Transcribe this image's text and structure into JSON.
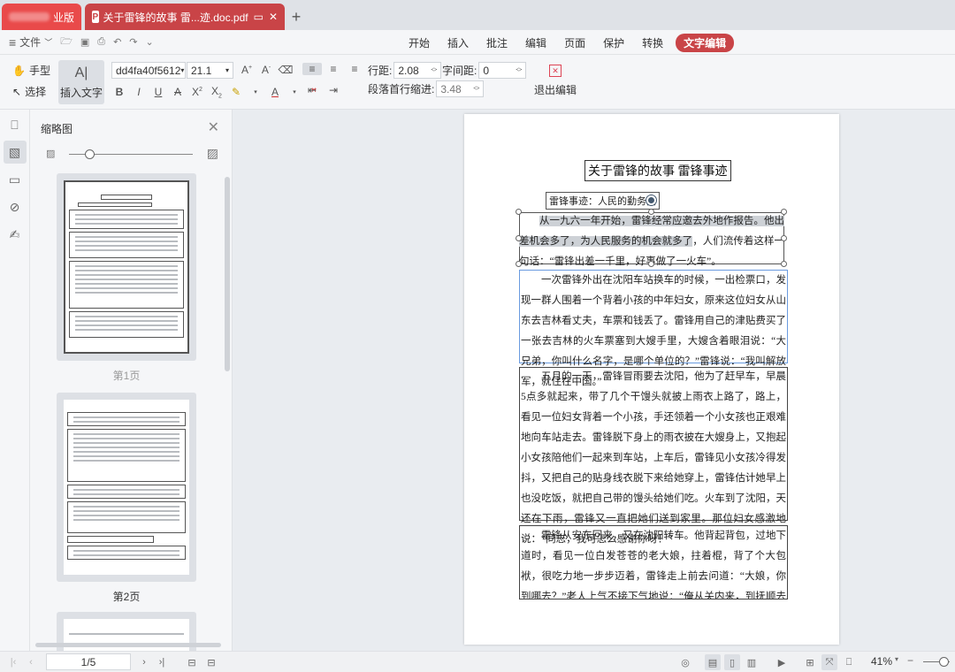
{
  "tabs": {
    "home_label": "业版",
    "active_label": "关于雷锋的故事 雷...迹.doc.pdf",
    "new_tab": "+"
  },
  "menubar": {
    "file_label": "文件",
    "tabs": [
      "开始",
      "插入",
      "批注",
      "编辑",
      "页面",
      "保护",
      "转换",
      "文字编辑"
    ],
    "active_tab": "文字编辑"
  },
  "toolbar": {
    "hand_label": "手型",
    "select_label": "选择",
    "insert_text_label": "插入文字",
    "font_name": "dd4fa40f5612",
    "font_size": "21.1",
    "line_spacing_label": "行距:",
    "line_spacing_value": "2.08",
    "char_spacing_label": "字间距:",
    "char_spacing_value": "0",
    "indent_label": "段落首行缩进:",
    "indent_value": "3.48",
    "exit_label": "退出编辑"
  },
  "thumbnail_panel": {
    "title": "缩略图",
    "pages": [
      "第1页",
      "第2页"
    ]
  },
  "document": {
    "title": "关于雷锋的故事 雷锋事迹",
    "subheading": "雷锋事迹：人民的勤务员",
    "para1_hl1": "从一九六一年开始，雷锋经常应邀去外地作报告。他出差机会多",
    "para1_hl2": "了，为人民服务的机会就多了",
    "para1_rest": "，人们流传着这样一句话：“雷锋出差一千里，好事做了一火车”。",
    "para2": "一次雷锋外出在沈阳车站换车的时候，一出检票口，发现一群人围着一个背着小孩的中年妇女，原来这位妇女从山东去吉林看丈夫，车票和钱丢了。雷锋用自己的津贴费买了一张去吉林的火车票塞到大嫂手里，大嫂含着眼泪说：“大兄弟，你叫什么名字，是哪个单位的？”雷锋说：“我叫解放军，就住在中国。”",
    "para3": "五月的一天，雷锋冒雨要去沈阳，他为了赶早车，早晨5点多就起来，带了几个干馒头就披上雨衣上路了，路上，看见一位妇女背着一个小孩，手还领着一个小女孩也正艰难地向车站走去。雷锋脱下身上的雨衣披在大嫂身上，又抱起小女孩陪他们一起来到车站，上车后，雷锋见小女孩冷得发抖，又把自己的贴身线衣脱下来给她穿上，雷锋估计她早上也没吃饭，就把自己带的馒头给她们吃。火车到了沈阳，天还在下雨，雷锋又一直把她们送到家里。那位妇女感激地说：“同志，我可怎么感谢你呀！”",
    "para4": "雷锋从安东回来，又在沈阳转车。他背起背包，过地下道时，看见一位白发苍苍的老大娘，拄着棍，背了个大包袱，很吃力地一步步迈着，雷锋走上前去问道：“大娘，你到哪去？”老人上气不接下气地说：“俺从关内来，到抚顺去看儿子呀！”雷锋一听跟自己同路，立刻"
  },
  "statusbar": {
    "page_indicator": "1/5",
    "zoom": "41%"
  }
}
